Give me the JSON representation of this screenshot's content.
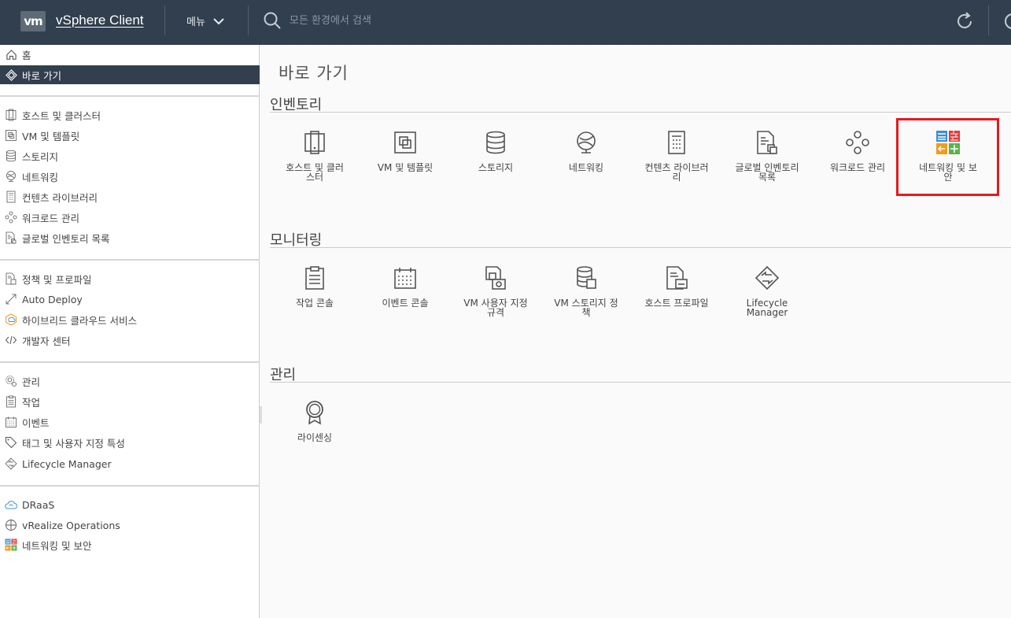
{
  "header": {
    "logo": "vm",
    "app_title": "vSphere Client",
    "menu_label": "메뉴",
    "search_placeholder": "모든 환경에서 검색"
  },
  "sidebar": {
    "groups": [
      [
        {
          "label": "홈",
          "icon": "home-icon"
        },
        {
          "label": "바로 가기",
          "icon": "shortcuts-icon",
          "active": true
        }
      ],
      [
        {
          "label": "호스트 및 클러스터",
          "icon": "hosts-clusters-icon"
        },
        {
          "label": "VM 및 템플릿",
          "icon": "vm-templates-icon"
        },
        {
          "label": "스토리지",
          "icon": "storage-icon"
        },
        {
          "label": "네트워킹",
          "icon": "networking-icon"
        },
        {
          "label": "컨텐츠 라이브러리",
          "icon": "content-library-icon"
        },
        {
          "label": "워크로드 관리",
          "icon": "workload-icon"
        },
        {
          "label": "글로벌 인벤토리 목록",
          "icon": "global-inventory-icon"
        }
      ],
      [
        {
          "label": "정책 및 프로파일",
          "icon": "policies-icon"
        },
        {
          "label": "Auto Deploy",
          "icon": "auto-deploy-icon"
        },
        {
          "label": "하이브리드 클라우드 서비스",
          "icon": "hybrid-cloud-icon"
        },
        {
          "label": "개발자 센터",
          "icon": "code-icon"
        }
      ],
      [
        {
          "label": "관리",
          "icon": "administration-icon"
        },
        {
          "label": "작업",
          "icon": "tasks-icon"
        },
        {
          "label": "이벤트",
          "icon": "events-icon"
        },
        {
          "label": "태그 및 사용자 지정 특성",
          "icon": "tag-icon"
        },
        {
          "label": "Lifecycle Manager",
          "icon": "lifecycle-icon"
        }
      ],
      [
        {
          "label": "DRaaS",
          "icon": "draas-cloud-icon"
        },
        {
          "label": "vRealize Operations",
          "icon": "vrealize-icon"
        },
        {
          "label": "네트워킹 및 보안",
          "icon": "nsx-icon"
        }
      ]
    ]
  },
  "main": {
    "page_title": "바로 가기",
    "sections": [
      {
        "title": "인벤토리",
        "tiles": [
          {
            "label": "호스트 및 클러\n스터",
            "icon": "hosts-clusters-icon"
          },
          {
            "label": "VM 및 템플릿",
            "icon": "vm-templates-icon"
          },
          {
            "label": "스토리지",
            "icon": "storage-icon"
          },
          {
            "label": "네트워킹",
            "icon": "networking-icon"
          },
          {
            "label": "컨텐츠 라이브러\n리",
            "icon": "content-library-icon"
          },
          {
            "label": "글로벌 인벤토리\n목록",
            "icon": "global-inventory-icon"
          },
          {
            "label": "워크로드 관리",
            "icon": "workload-icon"
          },
          {
            "label": "네트워킹 및 보\n안",
            "icon": "nsx-icon"
          }
        ]
      },
      {
        "title": "모니터링",
        "tiles": [
          {
            "label": "작업 콘솔",
            "icon": "task-console-icon"
          },
          {
            "label": "이벤트 콘솔",
            "icon": "event-console-icon"
          },
          {
            "label": "VM 사용자 지정\n규격",
            "icon": "vm-customization-icon"
          },
          {
            "label": "VM 스토리지 정\n책",
            "icon": "vm-storage-policy-icon"
          },
          {
            "label": "호스트 프로파일",
            "icon": "host-profiles-icon"
          },
          {
            "label": "Lifecycle\nManager",
            "icon": "lifecycle-icon"
          }
        ]
      },
      {
        "title": "관리",
        "tiles": [
          {
            "label": "라이센싱",
            "icon": "licensing-icon"
          }
        ]
      }
    ]
  },
  "colors": {
    "header_bg": "#313f4e",
    "active_item_bg": "#313f4e",
    "highlight_border": "#e8171e"
  }
}
